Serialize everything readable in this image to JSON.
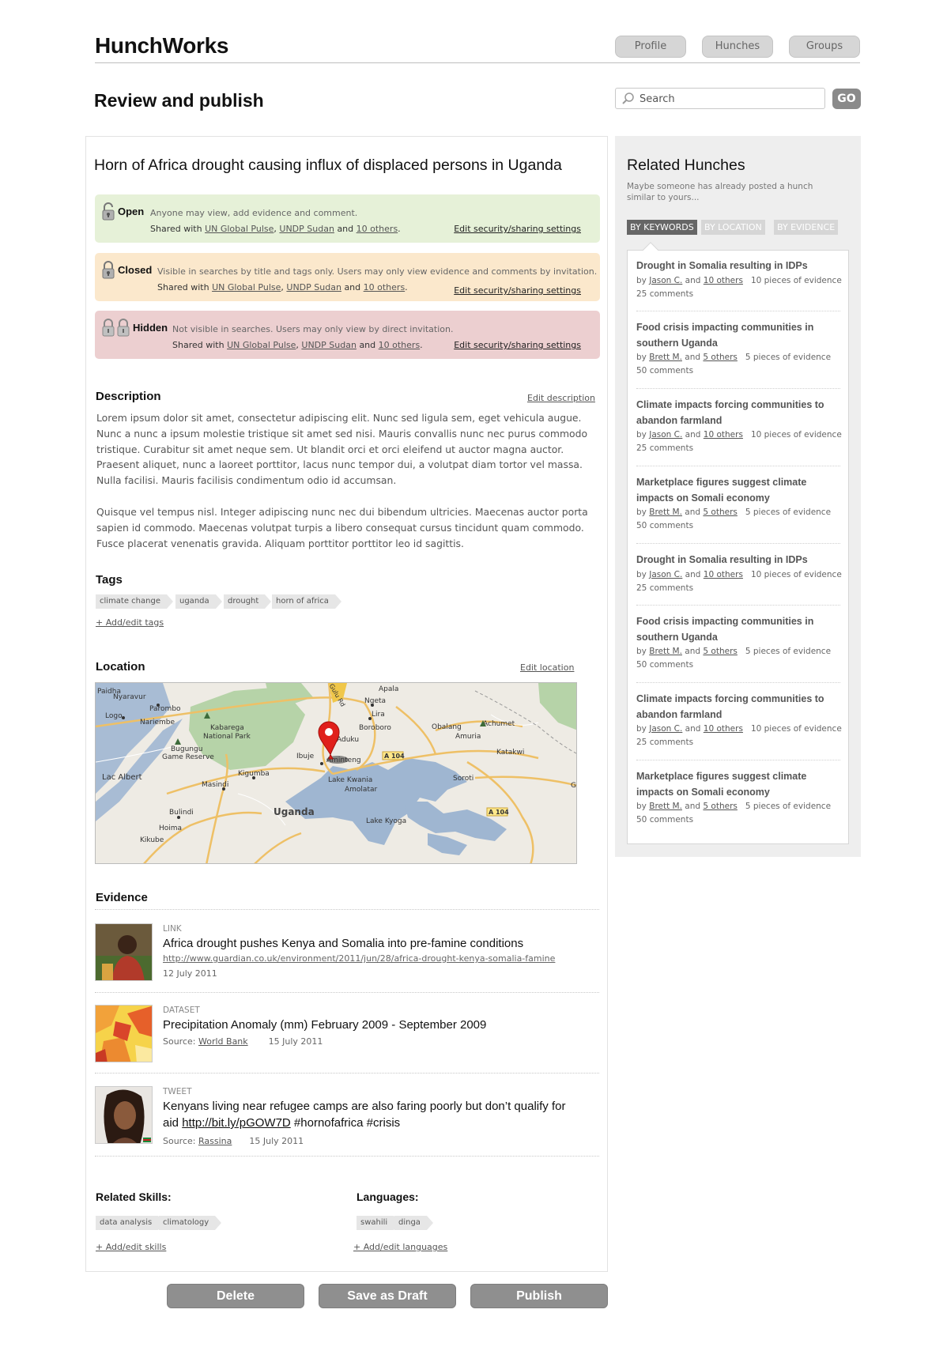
{
  "app": {
    "logo": "HunchWorks"
  },
  "nav": {
    "profile": "Profile",
    "hunches": "Hunches",
    "groups": "Groups"
  },
  "page": {
    "title": "Review and publish"
  },
  "search": {
    "placeholder": "Search",
    "go_label": "GO"
  },
  "hunch": {
    "title": "Horn of Africa drought causing influx of displaced persons in Uganda",
    "security": [
      {
        "name": "Open",
        "description": "Anyone may view, add evidence and comment.",
        "shared_prefix": "Shared with",
        "org1": "UN Global Pulse",
        "org2": "UNDP Sudan",
        "and": "and",
        "others": "10 others",
        "edit": "Edit security/sharing settings",
        "color": "#e6f1d8"
      },
      {
        "name": "Closed",
        "description": "Visible in searches by title and tags only. Users may only view evidence and comments by invitation.",
        "shared_prefix": "Shared with",
        "org1": "UN Global Pulse",
        "org2": "UNDP Sudan",
        "and": "and",
        "others": "10 others",
        "edit": "Edit security/sharing settings",
        "color": "#fbe8cc"
      },
      {
        "name": "Hidden",
        "description": "Not visible in searches. Users may only view by direct invitation.",
        "shared_prefix": "Shared with",
        "org1": "UN Global Pulse",
        "org2": "UNDP Sudan",
        "and": "and",
        "others": "10 others",
        "edit": "Edit security/sharing settings",
        "color": "#eccfd0"
      }
    ],
    "description": {
      "heading": "Description",
      "edit": "Edit description",
      "p1": "Lorem ipsum dolor sit amet, consectetur adipiscing elit. Nunc sed ligula sem, eget vehicula augue. Nunc a nunc a ipsum molestie tristique sit amet sed nisi. Mauris convallis nunc nec purus commodo tristique. Curabitur sit amet neque sem. Ut blandit orci et orci eleifend ut auctor magna auctor. Praesent aliquet, nunc a laoreet porttitor, lacus nunc tempor dui, a volutpat diam tortor vel massa. Nulla facilisi. Mauris facilisis condimentum odio id accumsan.",
      "p2": "Quisque vel tempus nisl. Integer adipiscing nunc nec dui bibendum ultricies. Maecenas auctor porta sapien id commodo. Maecenas volutpat turpis a libero consequat cursus tincidunt quam commodo. Fusce placerat venenatis gravida. Aliquam porttitor porttitor leo id sagittis."
    },
    "tags": {
      "heading": "Tags",
      "items": [
        "climate change",
        "uganda",
        "drought",
        "horn of africa"
      ],
      "add": "+ Add/edit tags"
    },
    "location": {
      "heading": "Location",
      "edit": "Edit location",
      "map_labels": [
        "Paidha",
        "Nyaravur",
        "Parombo",
        "Logo",
        "Nariembe",
        "Kabarega",
        "National Park",
        "Bugungu",
        "Game Reserve",
        "Lac Albert",
        "Kigumba",
        "Masindi",
        "Bulindi",
        "Hoima",
        "Kikube",
        "Uganda",
        "Ibuje",
        "Aminteng",
        "Lake Kwania",
        "Amolatar",
        "Lake Kyoga",
        "Aduku",
        "Boroboro",
        "Lira",
        "Ngeta",
        "Apala",
        "Obalang",
        "Achumet",
        "Amuria",
        "Katakwi",
        "Soroti",
        "Ga",
        "A 104",
        "A 104",
        "Gulu Rd"
      ]
    },
    "evidence": {
      "heading": "Evidence",
      "items": [
        {
          "type": "LINK",
          "title": "Africa drought pushes Kenya and Somalia into pre-famine conditions",
          "url": "http://www.guardian.co.uk/environment/2011/jun/28/africa-drought-kenya-somalia-famine",
          "date": "12 July 2011"
        },
        {
          "type": "DATASET",
          "title": "Precipitation Anomaly (mm) February 2009 - September 2009",
          "source_label": "Source:",
          "source": "World Bank",
          "date": "15 July 2011"
        },
        {
          "type": "TWEET",
          "title_line1": "Kenyans living near refugee camps are also faring poorly but don’t qualify for",
          "title_line2_prefix": "aid",
          "title_link": "http://bit.ly/pGOW7D",
          "title_suffix": "#hornofafrica #crisis",
          "source_label": "Source:",
          "source": "Rassina",
          "date": "15 July 2011"
        }
      ]
    },
    "skills": {
      "heading": "Related Skills:",
      "items": [
        "data analysis",
        "climatology"
      ],
      "add": "+ Add/edit skills"
    },
    "languages": {
      "heading": "Languages:",
      "items": [
        "swahili",
        "dinga"
      ],
      "add": "+ Add/edit languages"
    }
  },
  "actions": {
    "delete": "Delete",
    "save_draft": "Save as Draft",
    "publish": "Publish"
  },
  "sidebar": {
    "title": "Related Hunches",
    "subtitle": "Maybe someone has already posted a hunch similar to yours...",
    "tabs": [
      "BY KEYWORDS",
      "BY LOCATION",
      "BY EVIDENCE"
    ],
    "items": [
      {
        "title": "Drought in Somalia resulting in IDPs",
        "by": "by",
        "user": "Jason C.",
        "and": "and",
        "others": "10 others",
        "evidence": "10 pieces of evidence",
        "comments": "25 comments"
      },
      {
        "title": "Food crisis impacting communities in southern Uganda",
        "by": "by",
        "user": "Brett M.",
        "and": "and",
        "others": "5 others",
        "evidence": "5 pieces of evidence",
        "comments": "50 comments"
      },
      {
        "title": "Climate impacts forcing communities to abandon farmland",
        "by": "by",
        "user": "Jason C.",
        "and": "and",
        "others": "10 others",
        "evidence": "10 pieces of evidence",
        "comments": "25 comments"
      },
      {
        "title": "Marketplace figures suggest climate impacts on Somali economy",
        "by": "by",
        "user": "Brett M.",
        "and": "and",
        "others": "5 others",
        "evidence": "5 pieces of evidence",
        "comments": "50 comments"
      },
      {
        "title": "Drought in Somalia resulting in IDPs",
        "by": "by",
        "user": "Jason C.",
        "and": "and",
        "others": "10 others",
        "evidence": "10 pieces of evidence",
        "comments": "25 comments"
      },
      {
        "title": "Food crisis impacting communities in southern Uganda",
        "by": "by",
        "user": "Brett M.",
        "and": "and",
        "others": "5 others",
        "evidence": "5 pieces of evidence",
        "comments": "50 comments"
      },
      {
        "title": "Climate impacts forcing communities to abandon farmland",
        "by": "by",
        "user": "Jason C.",
        "and": "and",
        "others": "10 others",
        "evidence": "10 pieces of evidence",
        "comments": "25 comments"
      },
      {
        "title": "Marketplace figures suggest climate impacts on Somali economy",
        "by": "by",
        "user": "Brett M.",
        "and": "and",
        "others": "5 others",
        "evidence": "5 pieces of evidence",
        "comments": "50 comments"
      }
    ]
  }
}
